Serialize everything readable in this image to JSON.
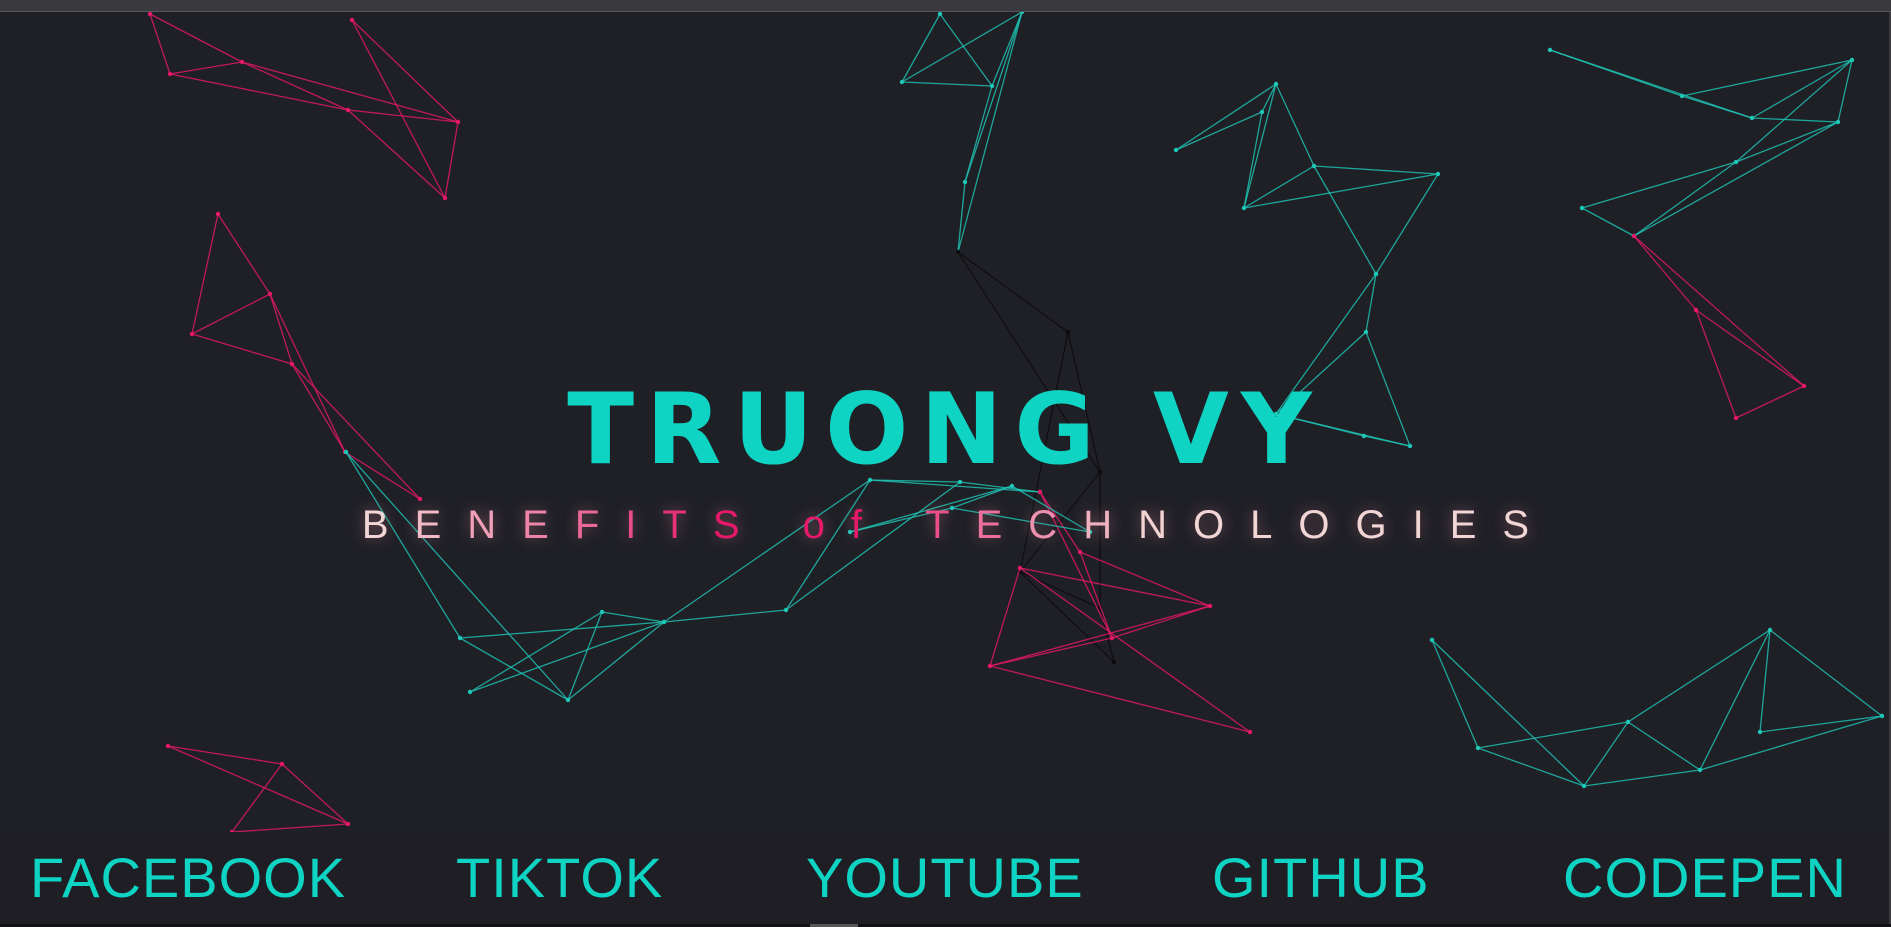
{
  "hero": {
    "title": "TRUONG VY",
    "subtitle": "BENEFITS of TECHNOLOGIES"
  },
  "nav": {
    "links": [
      {
        "label": "FACEBOOK"
      },
      {
        "label": "TIKTOK"
      },
      {
        "label": "YOUTUBE"
      },
      {
        "label": "GITHUB"
      },
      {
        "label": "CODEPEN"
      }
    ]
  },
  "colors": {
    "background": "#1f1f26",
    "accent_teal": "#0fd4c3",
    "accent_pink": "#e8186a",
    "subtitle_light": "#f2d6d6"
  }
}
